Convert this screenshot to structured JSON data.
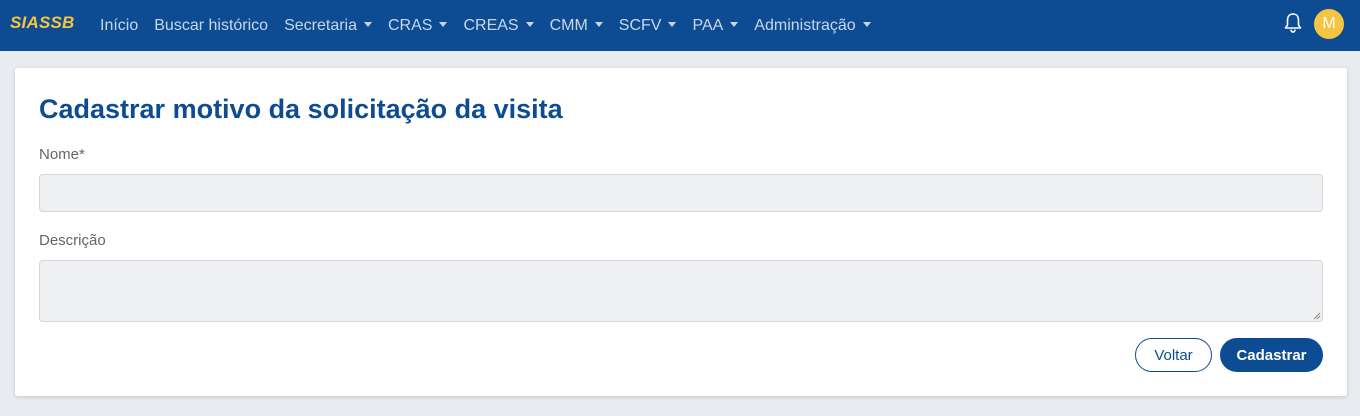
{
  "navbar": {
    "brand": "SIASSB",
    "items": [
      {
        "label": "Início",
        "dropdown": false
      },
      {
        "label": "Buscar histórico",
        "dropdown": false
      },
      {
        "label": "Secretaria",
        "dropdown": true
      },
      {
        "label": "CRAS",
        "dropdown": true
      },
      {
        "label": "CREAS",
        "dropdown": true
      },
      {
        "label": "CMM",
        "dropdown": true
      },
      {
        "label": "SCFV",
        "dropdown": true
      },
      {
        "label": "PAA",
        "dropdown": true
      },
      {
        "label": "Administração",
        "dropdown": true
      }
    ],
    "notification_icon": "bell-icon",
    "avatar_initial": "M"
  },
  "form": {
    "title": "Cadastrar motivo da solicitação da visita",
    "nome_label": "Nome*",
    "nome_value": "",
    "descricao_label": "Descrição",
    "descricao_value": "",
    "back_label": "Voltar",
    "submit_label": "Cadastrar"
  },
  "colors": {
    "primary": "#0d4c92",
    "brand_accent": "#f5c542",
    "background": "#e8ebef"
  }
}
